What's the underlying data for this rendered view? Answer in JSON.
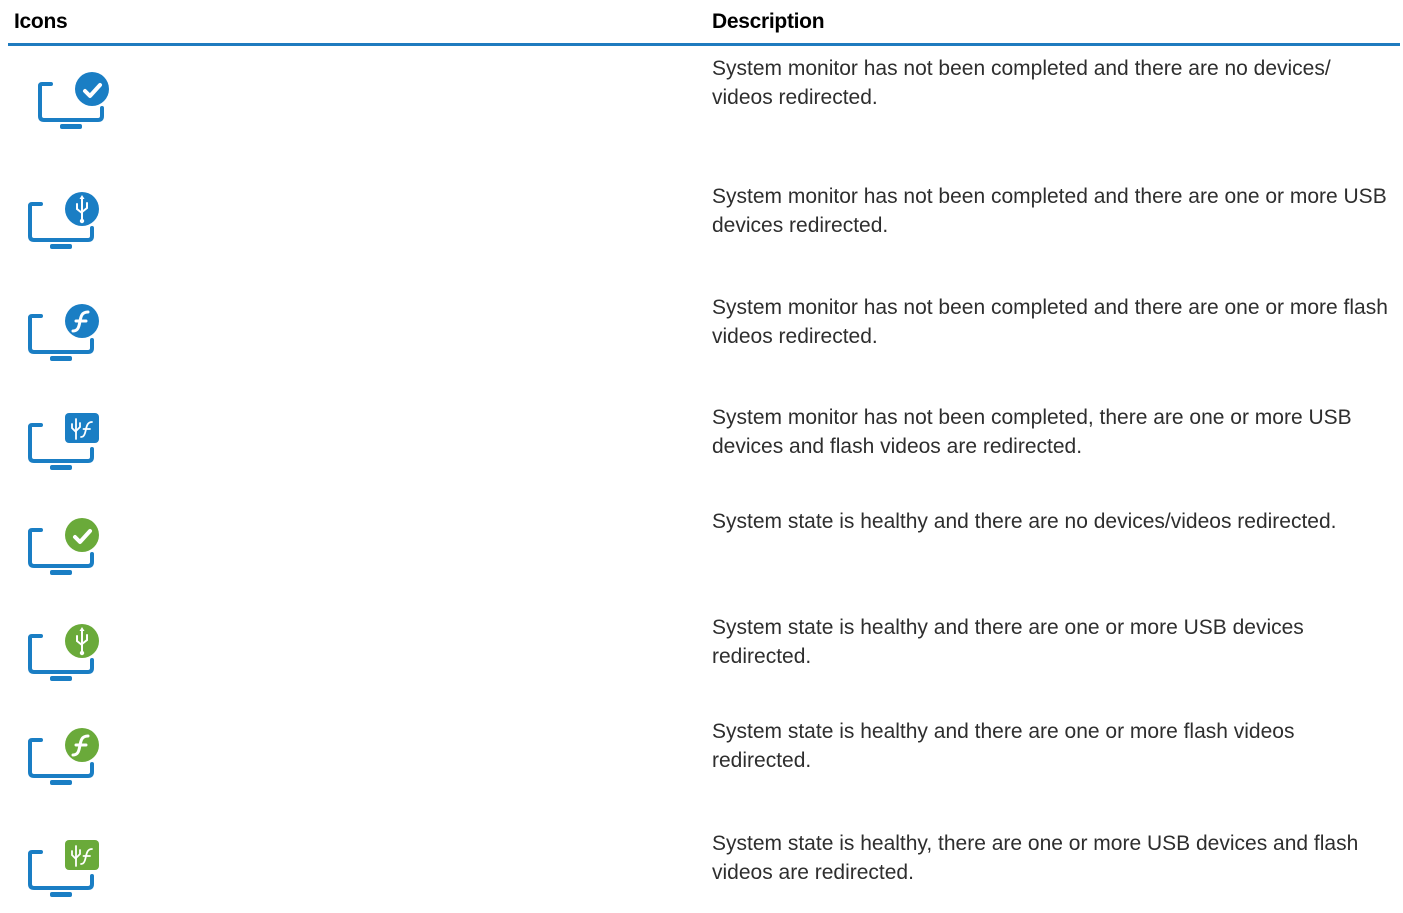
{
  "table": {
    "headers": {
      "icons": "Icons",
      "description": "Description"
    },
    "rows": [
      {
        "icon": "monitor-blue-check-icon",
        "badge_color": "#1a7ec4",
        "badge_shape": "circle",
        "glyph": "check",
        "description": "System monitor has not been completed and there are no devices/ videos redirected."
      },
      {
        "icon": "monitor-blue-usb-icon",
        "badge_color": "#1a7ec4",
        "badge_shape": "circle",
        "glyph": "usb",
        "description": "System monitor has not been completed and there are one or more USB devices redirected."
      },
      {
        "icon": "monitor-blue-flash-icon",
        "badge_color": "#1a7ec4",
        "badge_shape": "circle",
        "glyph": "flash",
        "description": "System monitor has not been completed and there are one or more flash videos redirected."
      },
      {
        "icon": "monitor-blue-usb-flash-icon",
        "badge_color": "#1a7ec4",
        "badge_shape": "square",
        "glyph": "usb-flash",
        "description": "System monitor has not been completed, there are one or more USB devices and flash videos are redirected."
      },
      {
        "icon": "monitor-green-check-icon",
        "badge_color": "#6aaa3a",
        "badge_shape": "circle",
        "glyph": "check",
        "description": "System state is healthy and there are no devices/videos redirected."
      },
      {
        "icon": "monitor-green-usb-icon",
        "badge_color": "#6aaa3a",
        "badge_shape": "circle",
        "glyph": "usb",
        "description": "System state is healthy and there are one or more USB devices redirected."
      },
      {
        "icon": "monitor-green-flash-icon",
        "badge_color": "#6aaa3a",
        "badge_shape": "circle",
        "glyph": "flash",
        "description": "System state is healthy and there are one or more flash videos redirected."
      },
      {
        "icon": "monitor-green-usb-flash-icon",
        "badge_color": "#6aaa3a",
        "badge_shape": "square",
        "glyph": "usb-flash",
        "description": "System state is healthy, there are one or more USB devices and flash videos are redirected."
      }
    ]
  },
  "colors": {
    "monitor": "#1a7ec4",
    "header_rule": "#1f7bbf"
  }
}
